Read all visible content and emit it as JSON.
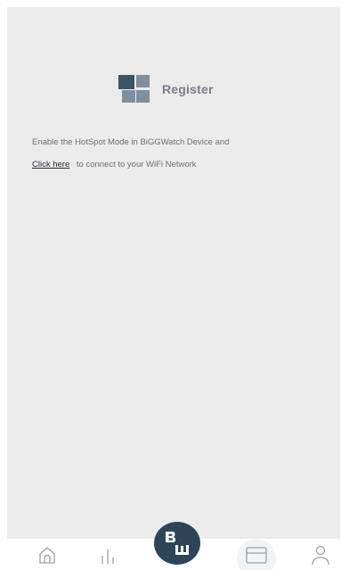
{
  "register": {
    "title": "Register"
  },
  "info": {
    "line1": "Enable the HotSpot Mode in BiGGWatch Device and",
    "link_label": "Click here",
    "line2_rest": "to connect to your WiFi Network"
  },
  "bottom_nav": {
    "items": [
      {
        "name": "home",
        "icon": "home-icon"
      },
      {
        "name": "stats",
        "icon": "bar-chart-icon"
      },
      {
        "name": "center",
        "icon": "biggwatch-logo"
      },
      {
        "name": "card",
        "icon": "card-icon"
      },
      {
        "name": "profile",
        "icon": "person-icon"
      }
    ],
    "center_logo_text": "BW"
  },
  "colors": {
    "background": "#ebebeb",
    "brand_dark": "#2c4558",
    "brand_light": "#7e8f9d",
    "text": "#6f6f6f"
  }
}
